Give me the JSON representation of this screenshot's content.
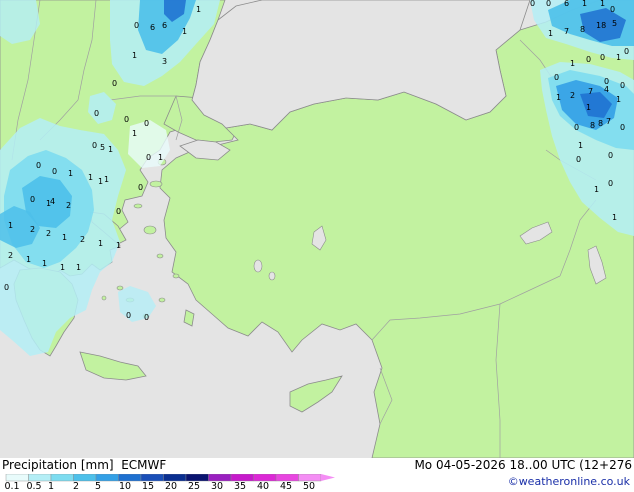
{
  "footer": {
    "product_label": "Precipitation [mm]",
    "model_label": "ECMWF",
    "valid_time": "Mo 04-05-2026 18..00 UTC (12+276",
    "credit": "©weatheronline.co.uk"
  },
  "legend": {
    "levels": [
      "0.1",
      "0.5",
      "1",
      "2",
      "5",
      "10",
      "15",
      "20",
      "25",
      "30",
      "35",
      "40",
      "45",
      "50"
    ],
    "colors": [
      "#e8fbfb",
      "#b4eef6",
      "#7ddcf0",
      "#4dc0ea",
      "#33a0e6",
      "#1e70d0",
      "#1a4fb8",
      "#0a2f90",
      "#0a1470",
      "#9a20c0",
      "#c61acb",
      "#dc28d6",
      "#e846e0",
      "#f48ef4"
    ]
  },
  "map_colors": {
    "sea": "#e4e4e4",
    "land": "#c2f2a0",
    "coast": "#8c8c8c",
    "border": "#a0a0a0"
  },
  "precip_values": [
    "0",
    "6",
    "1",
    "1",
    "6",
    "1",
    "3",
    "0",
    "0",
    "0",
    "0",
    "0",
    "5",
    "1",
    "1",
    "1",
    "0",
    "0",
    "0",
    "1",
    "0",
    "1",
    "4",
    "2",
    "1",
    "1",
    "1",
    "0",
    "2",
    "2",
    "1",
    "1",
    "2",
    "1",
    "1",
    "0",
    "2",
    "1",
    "1",
    "1",
    "1",
    "0",
    "0",
    "0",
    "0",
    "0",
    "6",
    "1",
    "1",
    "0",
    "1",
    "0",
    "0",
    "1",
    "7",
    "8",
    "18",
    "5",
    "0",
    "1",
    "0",
    "0",
    "0",
    "1",
    "7",
    "2",
    "4",
    "1",
    "1",
    "0",
    "0",
    "8",
    "7",
    "8",
    "1",
    "0",
    "0",
    "1",
    "1"
  ]
}
